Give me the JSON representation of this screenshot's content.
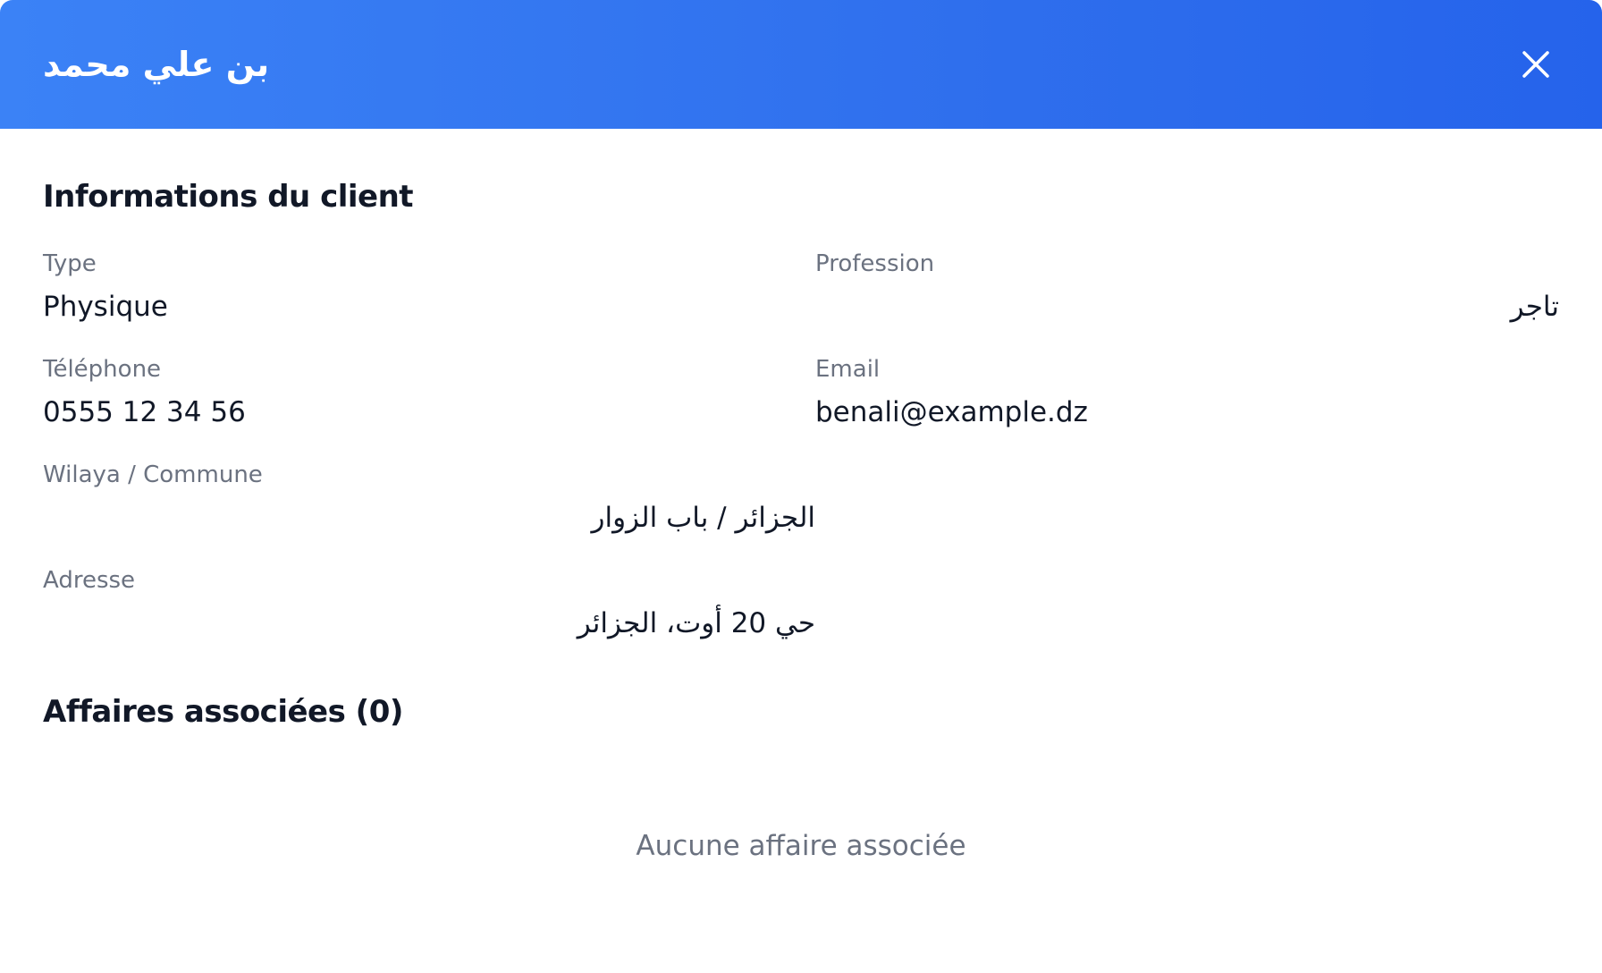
{
  "modal": {
    "title": "بن علي محمد"
  },
  "client_info": {
    "title": "Informations du client",
    "fields": [
      {
        "label": "Type",
        "value": "Physique"
      },
      {
        "label": "Profession",
        "value": "تاجر"
      },
      {
        "label": "Téléphone",
        "value": "0555 12 34 56"
      },
      {
        "label": "Email",
        "value": "benali@example.dz"
      },
      {
        "label": "Wilaya / Commune",
        "value": "الجزائر / باب الزوار"
      },
      {
        "label": "Adresse",
        "value": "حي 20 أوت، الجزائر"
      }
    ]
  },
  "affaires": {
    "title": "Affaires associées (0)",
    "empty_text": "Aucune affaire associée"
  },
  "colors": {
    "header_start": "#3b82f6",
    "header_end": "#2563eb",
    "label": "#6b7280",
    "text": "#111827"
  }
}
